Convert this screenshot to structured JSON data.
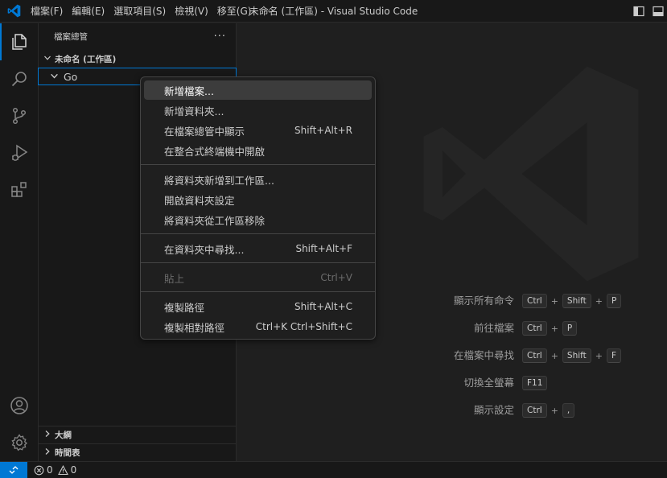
{
  "window": {
    "title": "未命名 (工作區) - Visual Studio Code",
    "menu": [
      "檔案(F)",
      "編輯(E)",
      "選取項目(S)",
      "檢視(V)",
      "移至(G)"
    ],
    "menu_more": "···"
  },
  "activity_bar": {
    "top": [
      "files-icon",
      "search-icon",
      "source-control-icon",
      "run-debug-icon",
      "extensions-icon"
    ],
    "bottom": [
      "account-icon",
      "settings-gear-icon"
    ]
  },
  "sidebar": {
    "title": "檔案總管",
    "more": "···",
    "workspace": "未命名 (工作區)",
    "folder": "Go",
    "sections": [
      "大綱",
      "時間表"
    ]
  },
  "context_menu": {
    "groups": [
      [
        {
          "label": "新增檔案...",
          "shortcut": ""
        },
        {
          "label": "新增資料夾...",
          "shortcut": ""
        },
        {
          "label": "在檔案總管中顯示",
          "shortcut": "Shift+Alt+R"
        },
        {
          "label": "在整合式終端機中開啟",
          "shortcut": ""
        }
      ],
      [
        {
          "label": "將資料夾新增到工作區...",
          "shortcut": ""
        },
        {
          "label": "開啟資料夾設定",
          "shortcut": ""
        },
        {
          "label": "將資料夾從工作區移除",
          "shortcut": ""
        }
      ],
      [
        {
          "label": "在資料夾中尋找...",
          "shortcut": "Shift+Alt+F"
        }
      ],
      [
        {
          "label": "貼上",
          "shortcut": "Ctrl+V"
        }
      ],
      [
        {
          "label": "複製路徑",
          "shortcut": "Shift+Alt+C"
        },
        {
          "label": "複製相對路徑",
          "shortcut": "Ctrl+K Ctrl+Shift+C"
        }
      ]
    ]
  },
  "editor": {
    "shortcuts": [
      {
        "label": "顯示所有命令",
        "keys": [
          "Ctrl",
          "Shift",
          "P"
        ]
      },
      {
        "label": "前往檔案",
        "keys": [
          "Ctrl",
          "P"
        ]
      },
      {
        "label": "在檔案中尋找",
        "keys": [
          "Ctrl",
          "Shift",
          "F"
        ]
      },
      {
        "label": "切換全螢幕",
        "keys": [
          "F11"
        ]
      },
      {
        "label": "顯示設定",
        "keys": [
          "Ctrl",
          ","
        ]
      }
    ],
    "key_plus": "+"
  },
  "status_bar": {
    "errors": "0",
    "warnings": "0"
  },
  "colors": {
    "accent": "#0078d4",
    "background": "#1f1f1f",
    "chrome": "#181818"
  }
}
